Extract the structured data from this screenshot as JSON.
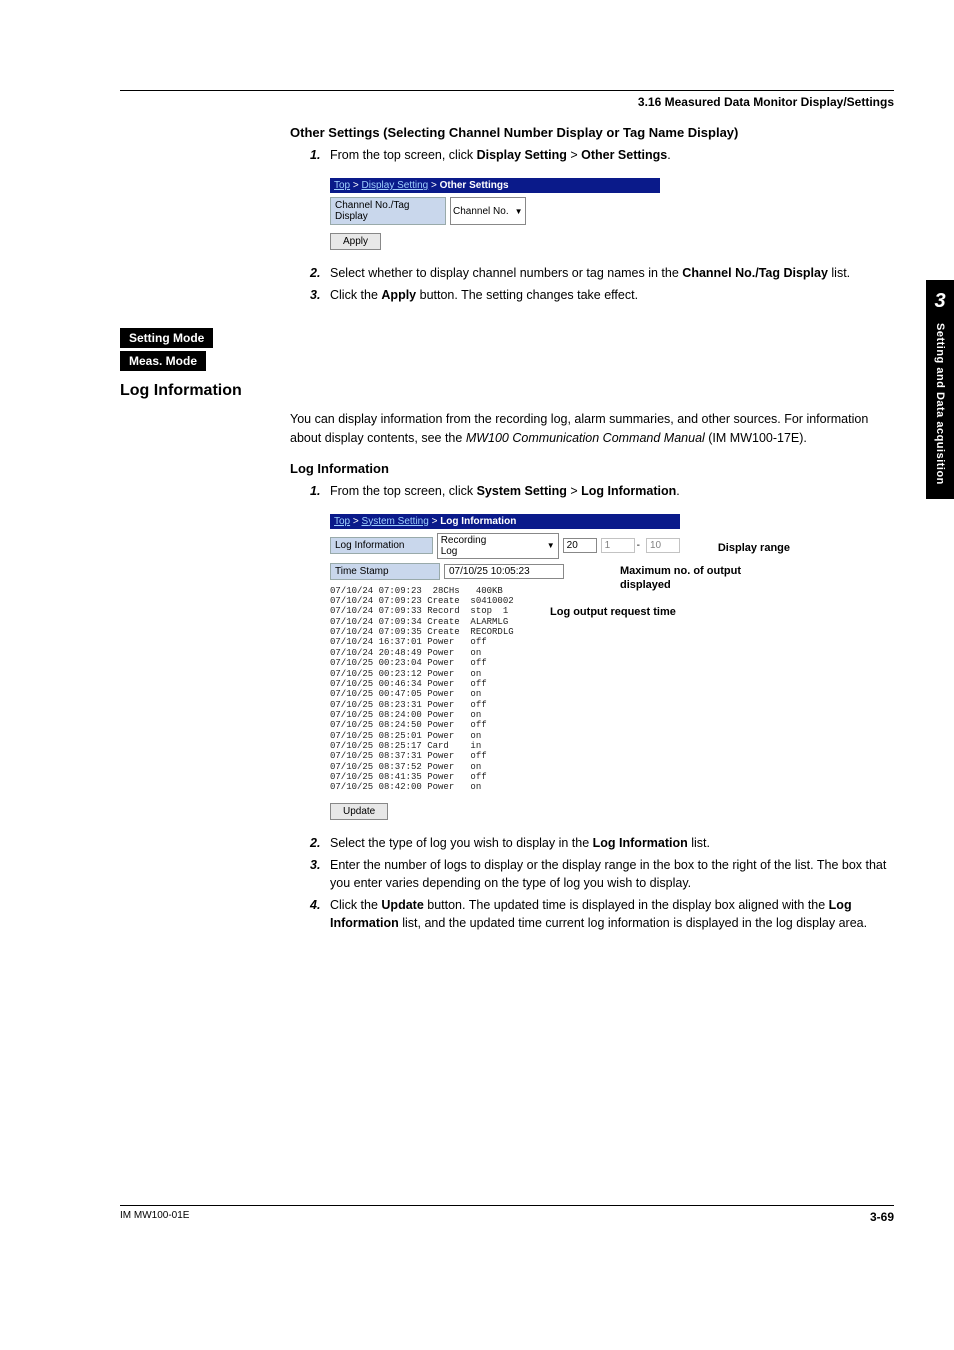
{
  "header": {
    "section": "3.16  Measured Data Monitor Display/Settings"
  },
  "sidetab": {
    "chapter": "3",
    "label": "Setting and Data acquisition"
  },
  "otherSettings": {
    "heading": "Other Settings (Selecting Channel Number Display or Tag Name Display)",
    "steps": {
      "s1a": "From the top screen, click ",
      "s1b": "Display Setting",
      "s1c": " > ",
      "s1d": "Other Settings",
      "s1e": ".",
      "s2a": "Select whether to display channel numbers or tag names in the ",
      "s2b": "Channel No./Tag Display",
      "s2c": " list.",
      "s3a": "Click the ",
      "s3b": "Apply",
      "s3c": " button. The setting changes take effect."
    },
    "shot": {
      "crumb_top": "Top",
      "crumb_ds": "Display Setting",
      "crumb_os": "Other Settings",
      "row_label": "Channel No./Tag Display",
      "row_value": "Channel No.",
      "apply": "Apply"
    }
  },
  "modes": {
    "setting": "Setting Mode",
    "meas": "Meas. Mode"
  },
  "logInfo": {
    "heading": "Log Information",
    "intro_a": "You can display information from the recording log, alarm summaries, and other sources. For information about display contents, see the ",
    "intro_b": "MW100 Communication Command Manual",
    "intro_c": " (IM MW100-17E).",
    "subheading": "Log Information",
    "steps": {
      "s1a": "From the top screen, click ",
      "s1b": "System Setting",
      "s1c": " > ",
      "s1d": "Log Information",
      "s1e": ".",
      "s2a": "Select the type of log you wish to display in the ",
      "s2b": "Log Information",
      "s2c": " list.",
      "s3": "Enter the number of logs to display or the display range in the box to the right of the list. The box that you enter varies depending on the type of log you wish to display.",
      "s4a": "Click the ",
      "s4b": "Update",
      "s4c": " button. The updated time is displayed in the display box aligned with the ",
      "s4d": "Log Information",
      "s4e": " list, and the updated time current log information is displayed in the log display area."
    },
    "shot": {
      "crumb_top": "Top",
      "crumb_ss": "System Setting",
      "crumb_li": "Log Information",
      "row1_label": "Log Information",
      "row1_value": "Recording Log",
      "row1_num": "20",
      "row1_r1": "1",
      "row1_r2": "10",
      "row2_label": "Time Stamp",
      "row2_value": "07/10/25 10:05:23",
      "update": "Update",
      "log_lines": "07/10/24 07:09:23  28CHs   400KB\n07/10/24 07:09:23 Create  s0410002\n07/10/24 07:09:33 Record  stop  1\n07/10/24 07:09:34 Create  ALARMLG\n07/10/24 07:09:35 Create  RECORDLG\n07/10/24 16:37:01 Power   off\n07/10/24 20:48:49 Power   on\n07/10/25 00:23:04 Power   off\n07/10/25 00:23:12 Power   on\n07/10/25 00:46:34 Power   off\n07/10/25 00:47:05 Power   on\n07/10/25 08:23:31 Power   off\n07/10/25 08:24:00 Power   on\n07/10/25 08:24:50 Power   off\n07/10/25 08:25:01 Power   on\n07/10/25 08:25:17 Card    in\n07/10/25 08:37:31 Power   off\n07/10/25 08:37:52 Power   on\n07/10/25 08:41:35 Power   off\n07/10/25 08:42:00 Power   on"
    },
    "callouts": {
      "range": "Display range",
      "max": "Maximum no. of output displayed",
      "time": "Log output request time"
    }
  },
  "footer": {
    "doc": "IM MW100-01E",
    "page": "3-69"
  },
  "nums": {
    "n1": "1.",
    "n2": "2.",
    "n3": "3.",
    "n4": "4."
  },
  "sep": {
    "gt": " > ",
    "dash": " - "
  }
}
